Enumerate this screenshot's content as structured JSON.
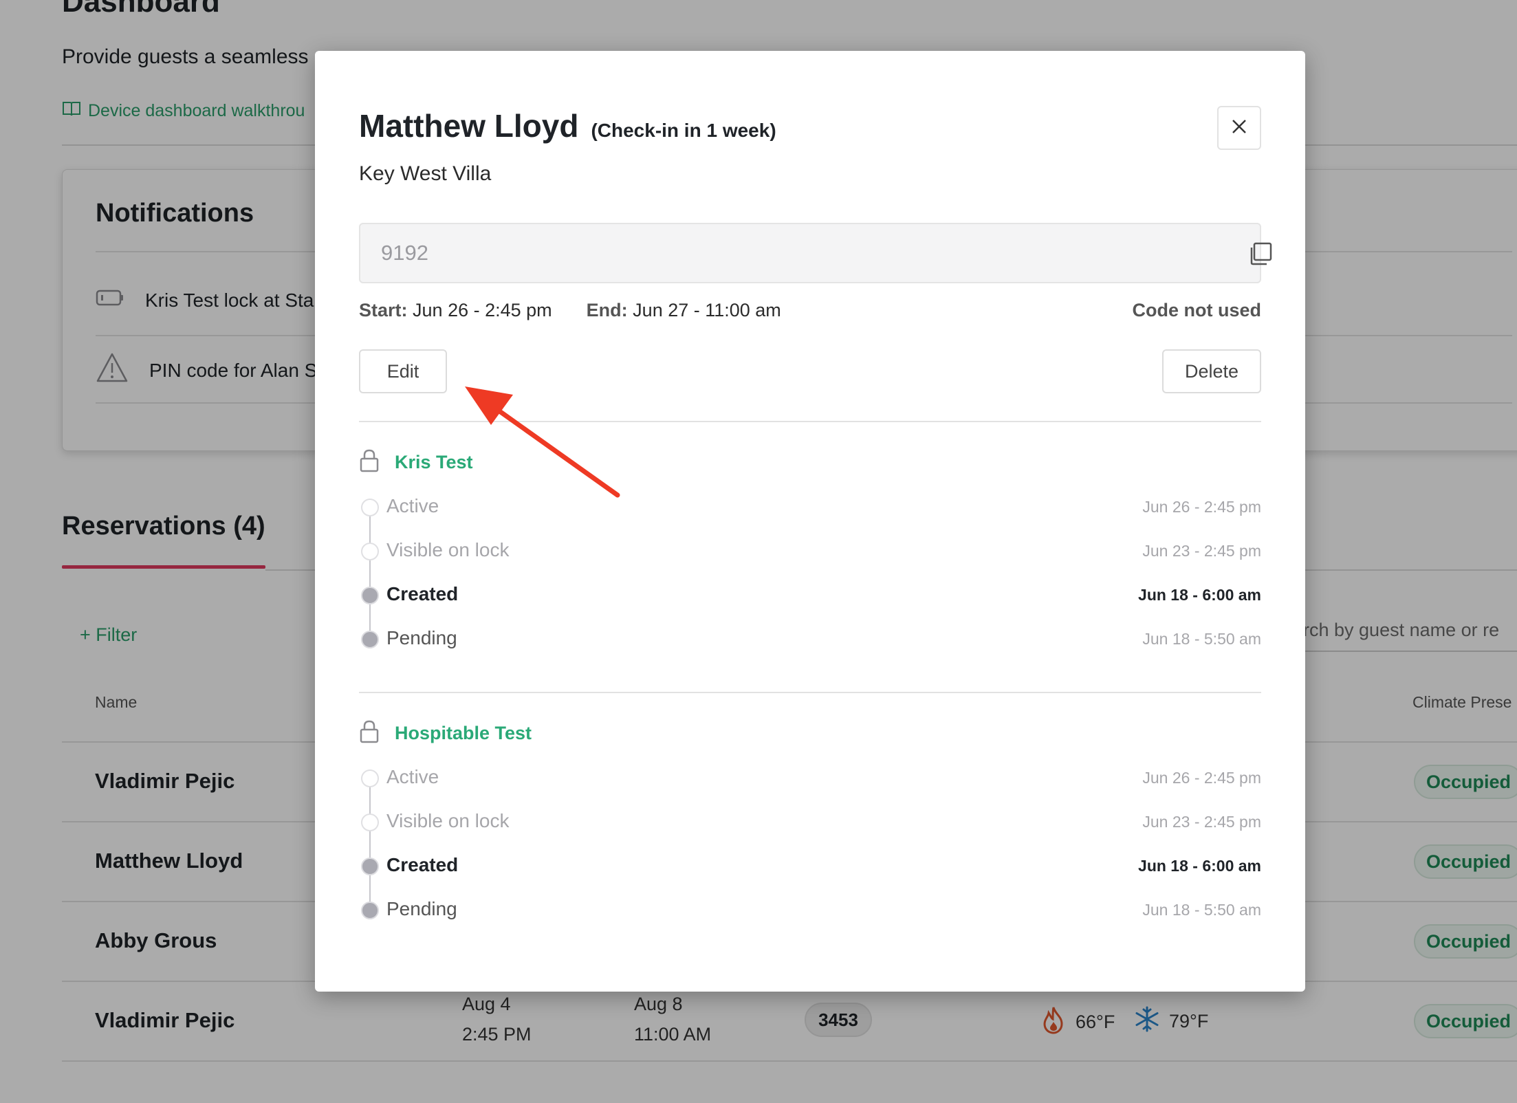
{
  "page": {
    "title": "Dashboard",
    "subtitle": "Provide guests a seamless",
    "walkthrough_link": "Device dashboard walkthrou"
  },
  "notifications": {
    "title": "Notifications",
    "items": [
      {
        "icon": "battery-icon",
        "text": "Kris Test lock at Sta"
      },
      {
        "icon": "warning-icon",
        "text": "PIN code for Alan S"
      }
    ]
  },
  "reservations": {
    "title": "Reservations (4)",
    "filter_label": "+ Filter",
    "search_placeholder": "arch by guest name or re",
    "columns": {
      "name": "Name",
      "climate": "Climate Prese"
    },
    "rows": [
      {
        "name": "Vladimir Pejic",
        "status": "Occupied"
      },
      {
        "name": "Matthew Lloyd",
        "status": "Occupied"
      },
      {
        "name": "Abby Grous",
        "status": "Occupied"
      },
      {
        "name": "Vladimir Pejic",
        "status": "Occupied",
        "start_date": "Aug 4",
        "start_time": "2:45 PM",
        "end_date": "Aug 8",
        "end_time": "11:00 AM",
        "code": "3453",
        "heat": "66°F",
        "cool": "79°F"
      }
    ]
  },
  "modal": {
    "guest_name": "Matthew Lloyd",
    "checkin_note": "(Check-in in 1 week)",
    "property": "Key West Villa",
    "code": "9192",
    "start_label": "Start:",
    "start_value": "Jun 26 - 2:45 pm",
    "end_label": "End:",
    "end_value": "Jun 27 - 11:00 am",
    "code_status": "Code not used",
    "edit_label": "Edit",
    "delete_label": "Delete",
    "locks": [
      {
        "name": "Kris Test",
        "events": [
          {
            "label": "Active",
            "time": "Jun 26 - 2:45 pm",
            "state": "future"
          },
          {
            "label": "Visible on lock",
            "time": "Jun 23 - 2:45 pm",
            "state": "future"
          },
          {
            "label": "Created",
            "time": "Jun 18 - 6:00 am",
            "state": "current"
          },
          {
            "label": "Pending",
            "time": "Jun 18 - 5:50 am",
            "state": "past"
          }
        ]
      },
      {
        "name": "Hospitable Test",
        "events": [
          {
            "label": "Active",
            "time": "Jun 26 - 2:45 pm",
            "state": "future"
          },
          {
            "label": "Visible on lock",
            "time": "Jun 23 - 2:45 pm",
            "state": "future"
          },
          {
            "label": "Created",
            "time": "Jun 18 - 6:00 am",
            "state": "current"
          },
          {
            "label": "Pending",
            "time": "Jun 18 - 5:50 am",
            "state": "past"
          }
        ]
      }
    ]
  },
  "colors": {
    "accent_green": "#2aa977",
    "tab_underline": "#e0395e",
    "annotation_arrow": "#ee3a24"
  }
}
